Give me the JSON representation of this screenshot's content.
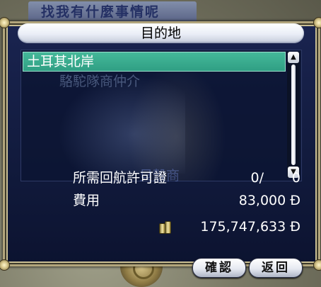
{
  "background": {
    "sign_text": "找我有什麼事情呢"
  },
  "dialog": {
    "title": "目的地",
    "destinations": [
      {
        "label": "土耳其北岸",
        "selected": true
      },
      {
        "label": "駱駝隊商仲介",
        "selected": false
      }
    ],
    "ghost_label": "貝殼商",
    "permit": {
      "label": "所需回航許可證",
      "current": "0/",
      "max": "0"
    },
    "fee": {
      "label": "費用",
      "value": "83,000 Đ"
    },
    "funds": {
      "value": "175,747,633 Đ",
      "icon": "coin-stack-icon"
    },
    "buttons": {
      "confirm": "確認",
      "back": "返回"
    },
    "colors": {
      "panel": "#111a3c",
      "selected_row": "#3aad90",
      "frame": "#b2a57c"
    }
  }
}
